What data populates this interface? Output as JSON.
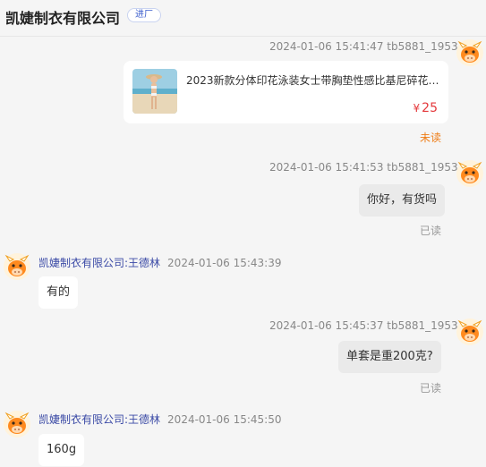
{
  "header": {
    "title": "凯婕制衣有限公司",
    "tag": "进厂"
  },
  "messages": [
    {
      "meta": "2024-01-06 15:41:47  tb5881_1953",
      "product": {
        "title": "2023新款分体印花泳装女士带胸垫性感比基尼碎花B...",
        "currency": "¥",
        "price": "25"
      },
      "status": "未读"
    },
    {
      "meta": "2024-01-06 15:41:53  tb5881_1953",
      "text": "你好，有货吗",
      "status": "已读"
    },
    {
      "sender": "凯婕制衣有限公司:王德林",
      "time": "2024-01-06 15:43:39",
      "text": "有的"
    },
    {
      "meta": "2024-01-06 15:45:37  tb5881_1953",
      "text": "单套是重200克?",
      "status": "已读"
    },
    {
      "sender": "凯婕制衣有限公司:王德林",
      "time": "2024-01-06 15:45:50",
      "text": "160g"
    }
  ]
}
